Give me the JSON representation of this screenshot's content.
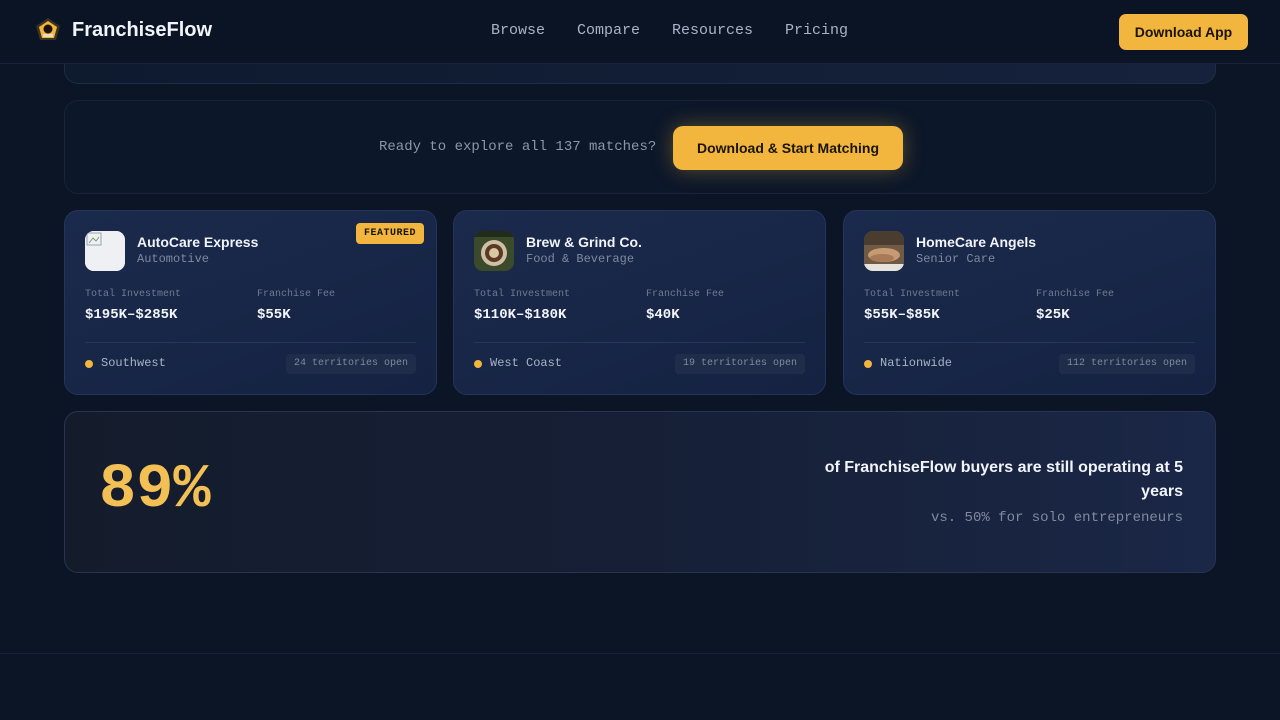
{
  "header": {
    "brand": "FranchiseFlow",
    "nav": [
      "Browse",
      "Compare",
      "Resources",
      "Pricing"
    ],
    "download_label": "Download App"
  },
  "cta": {
    "text": "Ready to explore all 137 matches?",
    "button_label": "Download & Start Matching"
  },
  "cards": [
    {
      "title": "AutoCare Express",
      "category": "Automotive",
      "featured": "FEATURED",
      "investment_label": "Total Investment",
      "investment": "$195K–$285K",
      "fee_label": "Franchise Fee",
      "fee": "$55K",
      "region": "Southwest",
      "territories": "24 territories open"
    },
    {
      "title": "Brew & Grind Co.",
      "category": "Food & Beverage",
      "investment_label": "Total Investment",
      "investment": "$110K–$180K",
      "fee_label": "Franchise Fee",
      "fee": "$40K",
      "region": "West Coast",
      "territories": "19 territories open"
    },
    {
      "title": "HomeCare Angels",
      "category": "Senior Care",
      "investment_label": "Total Investment",
      "investment": "$55K–$85K",
      "fee_label": "Franchise Fee",
      "fee": "$25K",
      "region": "Nationwide",
      "territories": "112 territories open"
    }
  ],
  "stat": {
    "value": "89%",
    "headline": "of FranchiseFlow buyers are still operating at 5 years",
    "sub": "vs. 50% for solo entrepreneurs"
  },
  "colors": {
    "accent": "#f2b53d",
    "background": "#0b1526",
    "card": "#1b2a4c"
  }
}
